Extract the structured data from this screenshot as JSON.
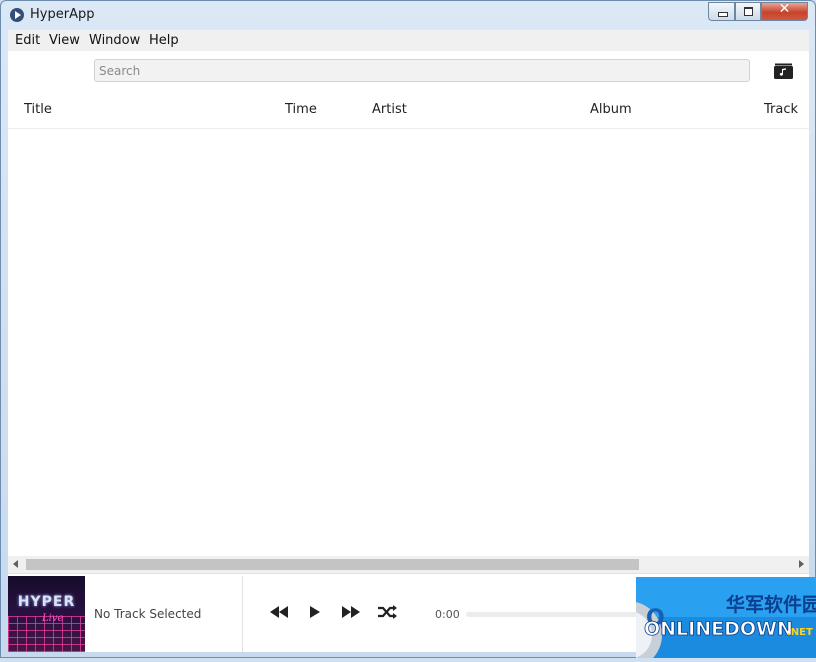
{
  "window": {
    "title": "HyperApp",
    "app_icon": "play-logo-icon"
  },
  "menu": [
    {
      "label": "Edit"
    },
    {
      "label": "View"
    },
    {
      "label": "Window"
    },
    {
      "label": "Help"
    }
  ],
  "search": {
    "placeholder": "Search",
    "value": ""
  },
  "library_button": {
    "icon": "music-library-icon"
  },
  "table": {
    "columns": [
      "Title",
      "Time",
      "Artist",
      "Album",
      "Track"
    ],
    "rows": []
  },
  "player": {
    "album_art": {
      "text": "HYPER",
      "script": "Live"
    },
    "now_playing": "No Track Selected",
    "controls": [
      "rewind-icon",
      "play-icon",
      "fast-forward-icon",
      "shuffle-icon"
    ],
    "time": "0:00",
    "progress": 0
  },
  "watermark": {
    "cn": "华军软件园",
    "logo": "ONLINEDOWN",
    "suffix": ".NET"
  },
  "colors": {
    "accent": "#34507a",
    "watermark_blue": "#1f8fe0",
    "watermark_gold": "#ffd21e"
  }
}
